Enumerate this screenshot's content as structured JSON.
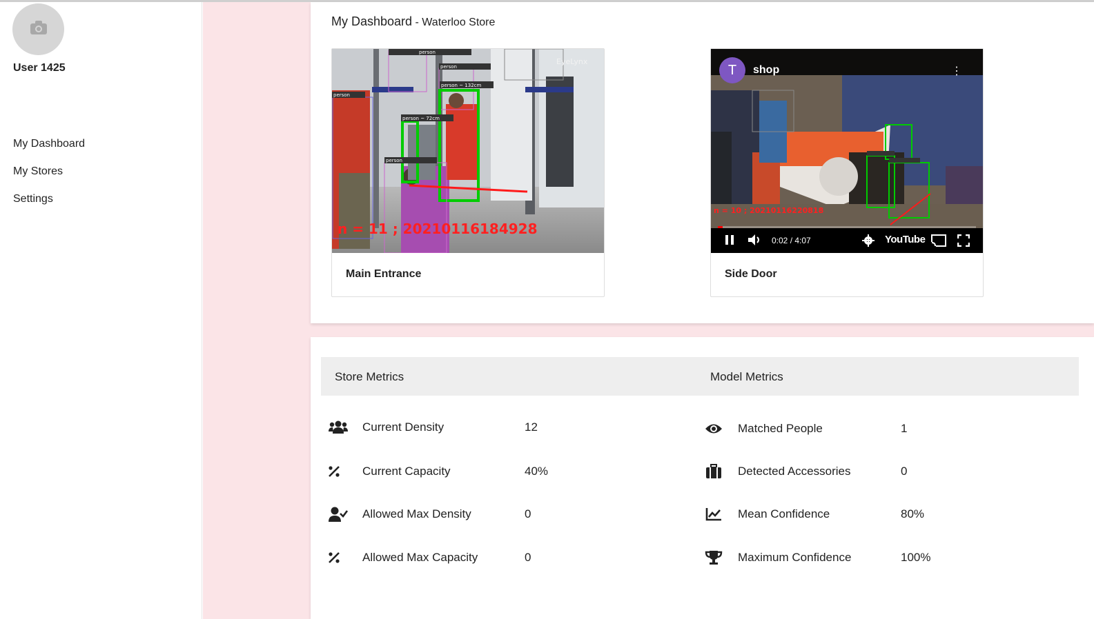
{
  "user": {
    "name": "User 1425",
    "avatar_icon": "camera-icon"
  },
  "nav": {
    "items": [
      {
        "label": "My Dashboard"
      },
      {
        "label": "My Stores"
      },
      {
        "label": "Settings"
      }
    ]
  },
  "dashboard": {
    "title": "My Dashboard",
    "separator": " - ",
    "store": "Waterloo Store"
  },
  "cameras": [
    {
      "label": "Main Entrance",
      "overlay_text": "n = 11 ; 20210116184928",
      "watermark": "EyeLynx",
      "detections": [
        "person",
        "person",
        "person ~ 132cm",
        "person",
        "person ~ 72cm",
        "person"
      ]
    },
    {
      "label": "Side Door",
      "channel_initial": "T",
      "video_title": "shop",
      "overlay_text": "n = 10 ; 20210116220818",
      "time": "0:02 / 4:07",
      "brand": "YouTube",
      "progress": 0.008
    }
  ],
  "store_metrics": {
    "title": "Store Metrics",
    "items": [
      {
        "icon": "users-icon",
        "label": "Current Density",
        "value": "12"
      },
      {
        "icon": "percent-icon",
        "label": "Current Capacity",
        "value": "40%"
      },
      {
        "icon": "user-check-icon",
        "label": "Allowed Max Density",
        "value": "0"
      },
      {
        "icon": "percent-icon",
        "label": "Allowed Max Capacity",
        "value": "0"
      }
    ]
  },
  "model_metrics": {
    "title": "Model Metrics",
    "items": [
      {
        "icon": "eye-icon",
        "label": "Matched People",
        "value": "1"
      },
      {
        "icon": "suitcase-icon",
        "label": "Detected Accessories",
        "value": "0"
      },
      {
        "icon": "chart-line-icon",
        "label": "Mean Confidence",
        "value": "80%"
      },
      {
        "icon": "trophy-icon",
        "label": "Maximum Confidence",
        "value": "100%"
      }
    ]
  },
  "colors": {
    "gutter": "#fbe4e7",
    "detection_box": "#00cc00",
    "overlay_text": "#ff2020",
    "youtube_red": "#ff0000",
    "channel_avatar": "#7e57c2"
  }
}
